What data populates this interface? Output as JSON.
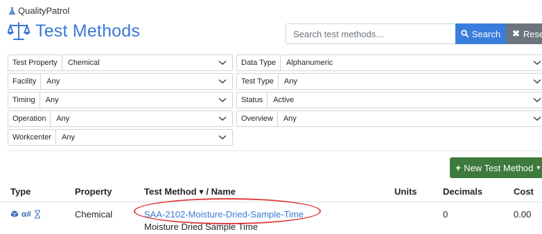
{
  "app": {
    "brand": "QualityPatrol"
  },
  "page": {
    "title": "Test Methods"
  },
  "search": {
    "placeholder": "Search test methods...",
    "search_label": "Search",
    "reset_label": "Reset"
  },
  "filters": {
    "test_property": {
      "label": "Test Property",
      "value": "Chemical"
    },
    "facility": {
      "label": "Facility",
      "value": "Any"
    },
    "timing": {
      "label": "Timing",
      "value": "Any"
    },
    "operation": {
      "label": "Operation",
      "value": "Any"
    },
    "workcenter": {
      "label": "Workcenter",
      "value": "Any"
    },
    "data_type": {
      "label": "Data Type",
      "value": "Alphanumeric"
    },
    "test_type": {
      "label": "Test Type",
      "value": "Any"
    },
    "status": {
      "label": "Status",
      "value": "Active"
    },
    "overview": {
      "label": "Overview",
      "value": "Any"
    }
  },
  "actions": {
    "new_test_method": "New Test Method"
  },
  "table": {
    "headers": {
      "type": "Type",
      "property": "Property",
      "test_method": "Test Method",
      "sort_indicator": "▾",
      "name_suffix": "/ Name",
      "units": "Units",
      "decimals": "Decimals",
      "cost": "Cost"
    },
    "rows": [
      {
        "type_icons": [
          "cube-icon",
          "alphanumeric-icon",
          "hourglass-icon"
        ],
        "type_text": "α#",
        "property": "Chemical",
        "code": "SAA-2102-Moisture-Dried-Sample-Time",
        "name": "Moisture Dried Sample Time",
        "units": "",
        "decimals": "0",
        "cost": "0.00"
      }
    ]
  },
  "colors": {
    "accent": "#3a78d6",
    "search_button": "#3b7ddd",
    "reset_button": "#6c757d",
    "new_button": "#3e7a3e",
    "highlight": "#e23b3b"
  }
}
